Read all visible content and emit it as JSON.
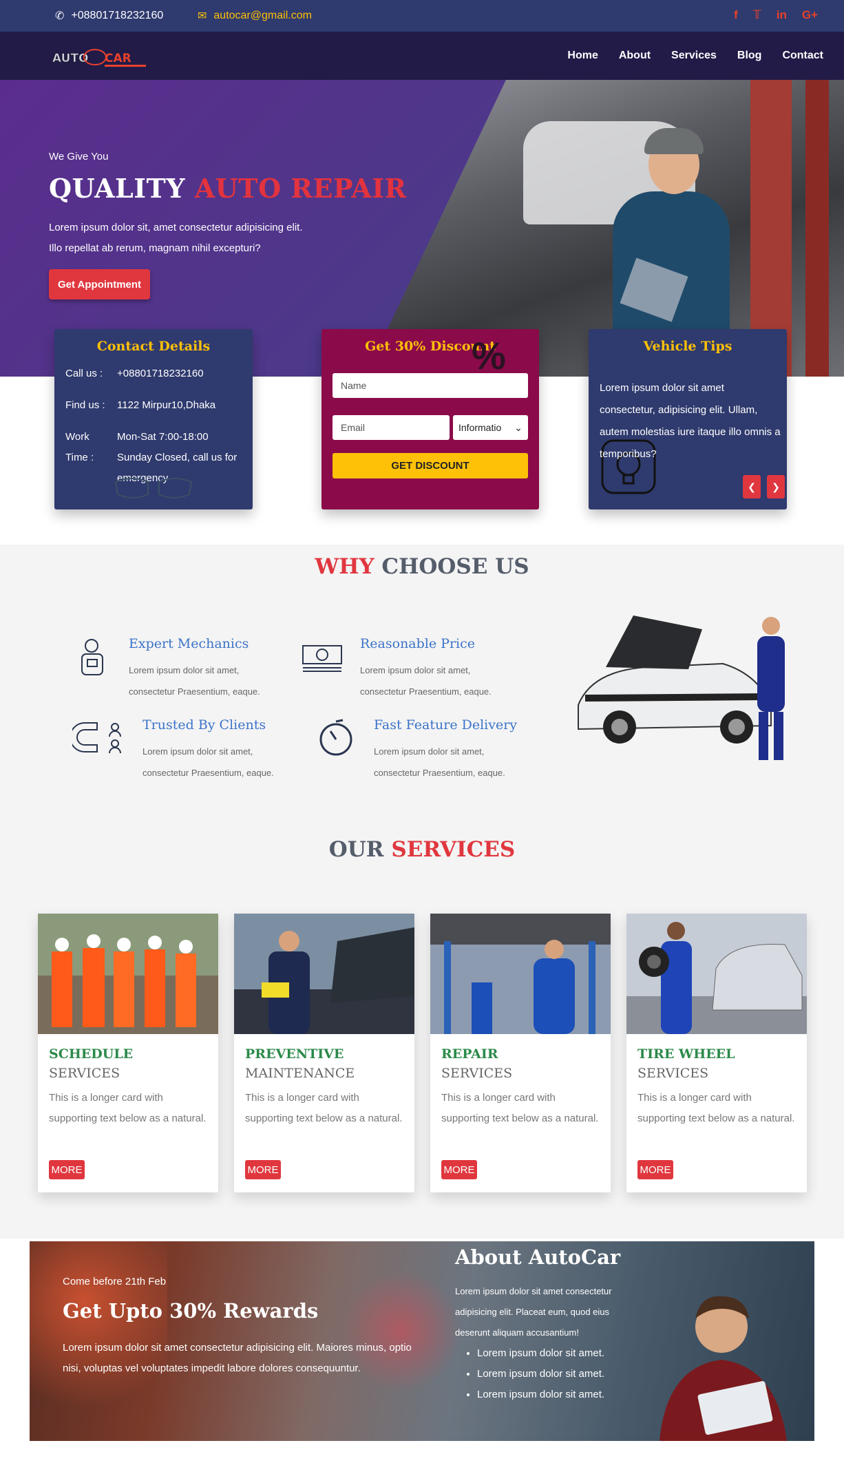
{
  "topbar": {
    "phone": "+08801718232160",
    "email": "autocar@gmail.com",
    "social": [
      "f",
      "t",
      "in",
      "G+"
    ]
  },
  "nav": {
    "logo_text": "AUTO CAR",
    "links": [
      "Home",
      "About",
      "Services",
      "Blog",
      "Contact"
    ]
  },
  "hero": {
    "pre": "We Give You",
    "title_white": "QUALITY",
    "title_red": "AUTO REPAIR",
    "line1": "Lorem ipsum dolor sit, amet consectetur adipisicing elit.",
    "line2": "Illo repellat ab rerum, magnam nihil excepturi?",
    "cta": "Get Appointment"
  },
  "contact": {
    "title": "Contact Details",
    "rows": [
      {
        "k": "Call us :",
        "v": "+08801718232160"
      },
      {
        "k": "Find us :",
        "v": "1122 Mirpur10,Dhaka"
      },
      {
        "k": "Work",
        "v": "Mon-Sat 7:00-18:00"
      },
      {
        "k": "Time :",
        "v": "Sunday Closed, call us for emergency"
      }
    ]
  },
  "discount": {
    "title": "Get 30% Discount",
    "name_placeholder": "Name",
    "email_placeholder": "Email",
    "select_value": "Informatio",
    "button": "GET DISCOUNT"
  },
  "tips": {
    "title": "Vehicle Tips",
    "text": "Lorem ipsum dolor sit amet consectetur, adipisicing elit. Ullam, autem molestias iure itaque illo omnis a temporibus?"
  },
  "why": {
    "title_red": "WHY",
    "title_gray": "CHOOSE US",
    "features": [
      {
        "title": "Expert Mechanics",
        "text": "Lorem ipsum dolor sit amet, consectetur Praesentium, eaque."
      },
      {
        "title": "Reasonable Price",
        "text": "Lorem ipsum dolor sit amet, consectetur Praesentium, eaque."
      },
      {
        "title": "Trusted By Clients",
        "text": "Lorem ipsum dolor sit amet, consectetur Praesentium, eaque."
      },
      {
        "title": "Fast Feature Delivery",
        "text": "Lorem ipsum dolor sit amet, consectetur Praesentium, eaque."
      }
    ]
  },
  "services": {
    "title_gray": "OUR",
    "title_red": "SERVICES",
    "cards": [
      {
        "title": "SCHEDULE",
        "subtitle": "SERVICES",
        "text": "This is a longer card with supporting text below as a natural.",
        "button": "MORE"
      },
      {
        "title": "PREVENTIVE",
        "subtitle": "MAINTENANCE",
        "text": "This is a longer card with supporting text below as a natural.",
        "button": "MORE"
      },
      {
        "title": "REPAIR",
        "subtitle": "SERVICES",
        "text": "This is a longer card with supporting text below as a natural.",
        "button": "MORE"
      },
      {
        "title": "TIRE WHEEL",
        "subtitle": "SERVICES",
        "text": "This is a longer card with supporting text below as a natural.",
        "button": "MORE"
      }
    ]
  },
  "promo": {
    "pre": "Come before 21th Feb",
    "title": "Get Upto 30% Rewards",
    "text": "Lorem ipsum dolor sit amet consectetur adipisicing elit. Maiores minus, optio nisi, voluptas vel voluptates impedit labore dolores consequuntur.",
    "about_title": "About AutoCar",
    "about_text": "Lorem ipsum dolor sit amet consectetur adipisicing elit. Placeat eum, quod eius deserunt aliquam accusantium!",
    "bullets": [
      "Lorem ipsum dolor sit amet.",
      "Lorem ipsum dolor sit amet.",
      "Lorem ipsum dolor sit amet."
    ]
  },
  "colors": {
    "topbar": "#2f3a6e",
    "nav": "#221b48",
    "accent_red": "#e0373f",
    "accent_yellow": "#ffc107",
    "discount_box": "#8b0a4a"
  }
}
